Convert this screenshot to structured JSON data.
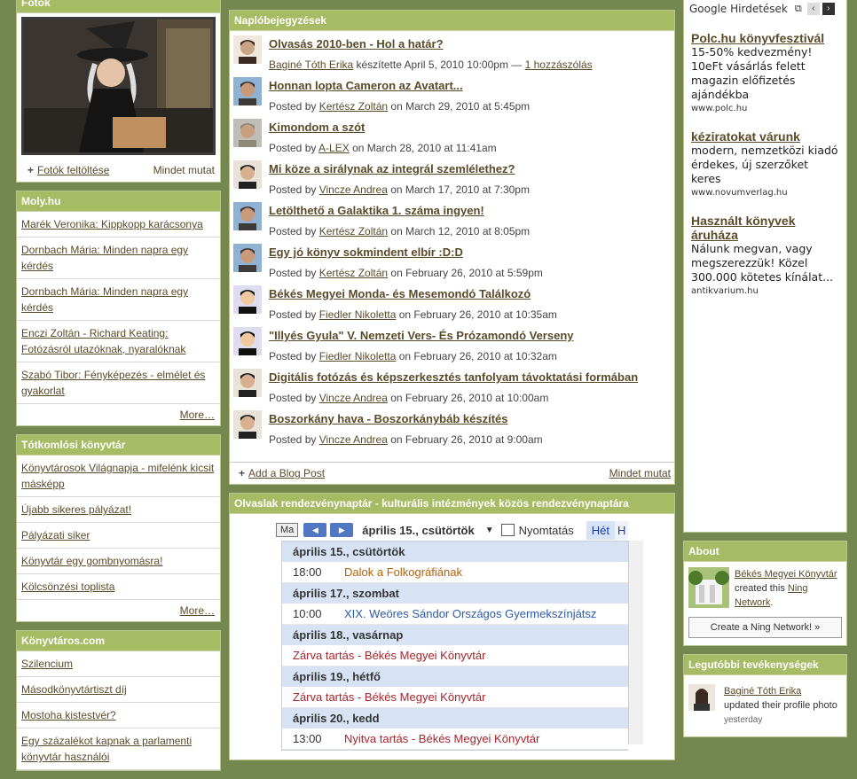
{
  "photos": {
    "title": "Fotók",
    "upload_label": "Fotók feltöltése",
    "show_all": "Mindet mutat"
  },
  "moly": {
    "title": "Moly.hu",
    "items": [
      "Marék Veronika: Kippkopp karácsonya",
      "Dornbach Mária: Minden napra egy kérdés",
      "Dornbach Mária: Minden napra egy kérdés",
      "Enczi Zoltán - Richard Keating: Fotózásról utazóknak, nyaralóknak",
      "Szabó Tibor: Fényképezés - elmélet és gyakorlat"
    ],
    "more": "More…"
  },
  "totkomlos": {
    "title": "Tótkomlósi könyvtár",
    "items": [
      "Könyvtárosok Világnapja - mifelénk kicsit másképp",
      "Újabb sikeres pályázat!",
      "Pályázati siker",
      "Könyvtár egy gombnyomásra!",
      "Kölcsönzési toplista"
    ],
    "more": "More…"
  },
  "konyvtaros": {
    "title": "Könyvtáros.com",
    "items": [
      "Szilencium",
      "Másodkönyvtártiszt díj",
      "Mostoha kistestvér?",
      "Egy százalékot kapnak a parlamenti könyvtár használói"
    ]
  },
  "blog": {
    "title": "Naplóbejegyzések",
    "entries": [
      {
        "title": "Olvasás 2010-ben - Hol a határ?",
        "prefix": "",
        "author": "Baginé Tóth Erika",
        "suffix": " készítette April 5, 2010 10:00pm — ",
        "comments": "1 hozzászólás"
      },
      {
        "title": "Honnan lopta Cameron az Avatart...",
        "prefix": "Posted by ",
        "author": "Kertész Zoltán",
        "suffix": " on March 29, 2010 at 5:45pm",
        "comments": ""
      },
      {
        "title": "Kimondom a szót",
        "prefix": "Posted by ",
        "author": "A-LEX",
        "suffix": " on March 28, 2010 at 11:41am",
        "comments": ""
      },
      {
        "title": "Mi köze a sirálynak az integrál szemlélethez?",
        "prefix": "Posted by ",
        "author": "Vincze Andrea",
        "suffix": " on March 17, 2010 at 7:30pm",
        "comments": ""
      },
      {
        "title": "Letölthető a Galaktika 1. száma ingyen!",
        "prefix": "Posted by ",
        "author": "Kertész Zoltán",
        "suffix": " on March 12, 2010 at 8:05pm",
        "comments": ""
      },
      {
        "title": "Egy jó könyv sokmindent elbír :D:D",
        "prefix": "Posted by ",
        "author": "Kertész Zoltán",
        "suffix": " on February 26, 2010 at 5:59pm",
        "comments": ""
      },
      {
        "title": "Békés Megyei Monda- és Mesemondó Találkozó",
        "prefix": "Posted by ",
        "author": "Fiedler Nikoletta",
        "suffix": " on February 26, 2010 at 10:35am",
        "comments": ""
      },
      {
        "title": "\"Illyés Gyula\" V. Nemzeti Vers- És Prózamondó Verseny",
        "prefix": "Posted by ",
        "author": "Fiedler Nikoletta",
        "suffix": " on February 26, 2010 at 10:32am",
        "comments": ""
      },
      {
        "title": "Digitális fotózás és képszerkesztés tanfolyam távoktatási formában",
        "prefix": "Posted by ",
        "author": "Vincze Andrea",
        "suffix": " on February 26, 2010 at 10:00am",
        "comments": ""
      },
      {
        "title": "Boszorkány hava - Boszorkánybáb készítés",
        "prefix": "Posted by ",
        "author": "Vincze Andrea",
        "suffix": " on February 26, 2010 at 9:00am",
        "comments": ""
      }
    ],
    "add_label": "Add a Blog Post",
    "show_all": "Mindet mutat"
  },
  "calendar": {
    "title": "Olvaslak rendezvénynaptár - kulturális intézmények közös rendezvénynaptára",
    "today_btn": "Ma",
    "current_date": "április 15., csütörtök",
    "print_label": "Nyomtatás",
    "tab_week": "Hét",
    "tab_next": "H",
    "rows": [
      {
        "kind": "day",
        "text": "április 15., csütörtök"
      },
      {
        "kind": "event",
        "time": "18:00",
        "text": "Dalok a Folkográfiának",
        "color": "orange"
      },
      {
        "kind": "day",
        "text": "április 17., szombat"
      },
      {
        "kind": "event",
        "time": "10:00",
        "text": "XIX. Weöres Sándor Országos Gyermekszínjátsz",
        "color": "blue"
      },
      {
        "kind": "day",
        "text": "április 18., vasárnap"
      },
      {
        "kind": "event",
        "time": "",
        "text": "Zárva tartás - Békés Megyei Könyvtár",
        "color": "red"
      },
      {
        "kind": "day",
        "text": "április 19., hétfő"
      },
      {
        "kind": "event",
        "time": "",
        "text": "Zárva tartás - Békés Megyei Könyvtár",
        "color": "red"
      },
      {
        "kind": "day",
        "text": "április 20., kedd"
      },
      {
        "kind": "event",
        "time": "13:00",
        "text": "Nyitva tartás - Békés Megyei Könyvtár",
        "color": "red"
      }
    ]
  },
  "ads": {
    "brand": "Google Hirdetések",
    "items": [
      {
        "title": "Polc.hu könyvfesztivál",
        "text": "15-50% kedvezmény! 10eFt vásárlás felett magazin előfizetés ajándékba",
        "url": "www.polc.hu"
      },
      {
        "title": "kéziratokat várunk",
        "text": "modern, nemzetközi kiadó érdekes, új szerzőket keres",
        "url": "www.novumverlag.hu"
      },
      {
        "title": "Használt könyvek áruháza",
        "text": "Nálunk megvan, vagy megszerezzük! Közel 300.000 kötetes kínálat...",
        "url": "antikvarium.hu"
      }
    ]
  },
  "about": {
    "title": "About",
    "network_name": "Békés Megyei Könyvtár",
    "created_text": "created this ",
    "network_link": "Ning Network",
    "create_button": "Create a Ning Network! »"
  },
  "activity": {
    "title": "Legutóbbi tevékenységek",
    "user": "Baginé Tóth Erika",
    "action": "updated their profile photo",
    "time": "yesterday"
  }
}
